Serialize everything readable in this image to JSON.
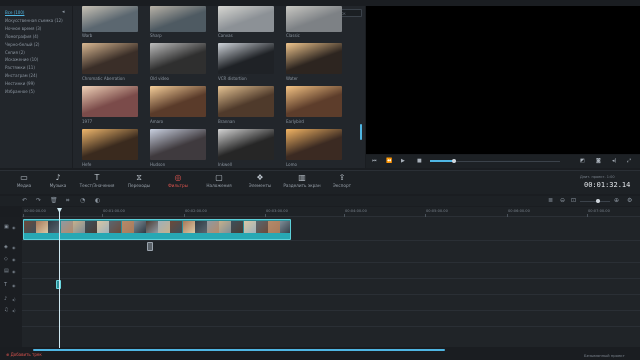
{
  "categories": {
    "items": [
      "Все (100)",
      "Искусственная съемка (12)",
      "Ночное время (3)",
      "Ломография (4)",
      "Черно-белый (2)",
      "Сепия (2)",
      "Искажение (10)",
      "Растяжки (11)",
      "Инстаграм (24)",
      "Нестинки (99)",
      "Избранное (5)"
    ],
    "active_index": 0
  },
  "browser": {
    "search_placeholder": "Поиск",
    "filters": [
      {
        "label": "Warb",
        "colors": [
          "#5b6770",
          "#c8c2b5"
        ]
      },
      {
        "label": "Sharp",
        "colors": [
          "#4e5a62",
          "#b9b3a8"
        ]
      },
      {
        "label": "Canvas",
        "colors": [
          "#8c9196",
          "#d7d7d2"
        ]
      },
      {
        "label": "Classic",
        "colors": [
          "#7d8185",
          "#c9c8c3"
        ]
      },
      {
        "label": "Chromatic Aberration",
        "colors": [
          "#3a2e28",
          "#d9b892"
        ]
      },
      {
        "label": "Old video",
        "colors": [
          "#2f2f2f",
          "#bdbdbd"
        ]
      },
      {
        "label": "VCR distortion",
        "colors": [
          "#1f2226",
          "#cfd4da"
        ]
      },
      {
        "label": "Water",
        "colors": [
          "#2d2520",
          "#f0c68e"
        ]
      },
      {
        "label": "1977",
        "colors": [
          "#7b4b4a",
          "#f0d2b8"
        ]
      },
      {
        "label": "Amaro",
        "colors": [
          "#5a3b2a",
          "#f6cf9a"
        ]
      },
      {
        "label": "Brannan",
        "colors": [
          "#4f3a2b",
          "#e6c494"
        ]
      },
      {
        "label": "Earlybird",
        "colors": [
          "#5d3d2b",
          "#f4c384"
        ]
      },
      {
        "label": "Hefe",
        "colors": [
          "#3a2a1e",
          "#efb76d"
        ]
      },
      {
        "label": "Hudson",
        "colors": [
          "#3f3a3e",
          "#c9d0e0"
        ]
      },
      {
        "label": "Inkwell",
        "colors": [
          "#262626",
          "#d4d4d4"
        ]
      },
      {
        "label": "Lomo",
        "colors": [
          "#3b2a22",
          "#f2b464"
        ]
      }
    ]
  },
  "toolbar": {
    "items": [
      {
        "label": "Медиа",
        "icon": "folder-icon"
      },
      {
        "label": "Музыка",
        "icon": "music-note-icon"
      },
      {
        "label": "Текст/Значения",
        "icon": "text-icon"
      },
      {
        "label": "Переходы",
        "icon": "transitions-icon"
      },
      {
        "label": "Фильтры",
        "icon": "filters-icon",
        "active": true
      },
      {
        "label": "Наложения",
        "icon": "overlays-icon"
      },
      {
        "label": "Элементы",
        "icon": "elements-icon"
      },
      {
        "label": "Разделить экран",
        "icon": "split-screen-icon"
      },
      {
        "label": "Экспорт",
        "icon": "export-icon"
      }
    ],
    "project_duration_label": "Длит. проект. 1:00",
    "timecode": "00:01:32.14"
  },
  "timeline": {
    "ruler": [
      "00:00:00.00",
      "00:01:00.00",
      "00:02:00.00",
      "00:03:00.00",
      "00:04:00.00",
      "00:05:00.00",
      "00:06:00.00",
      "00:07:00.00"
    ]
  },
  "status": {
    "add_track": "Добавить трек",
    "project_name": "Безымянный проект"
  },
  "colors": {
    "accent": "#4fb6e3",
    "active_tool": "#e0554f",
    "clip": "#2d8f98"
  }
}
